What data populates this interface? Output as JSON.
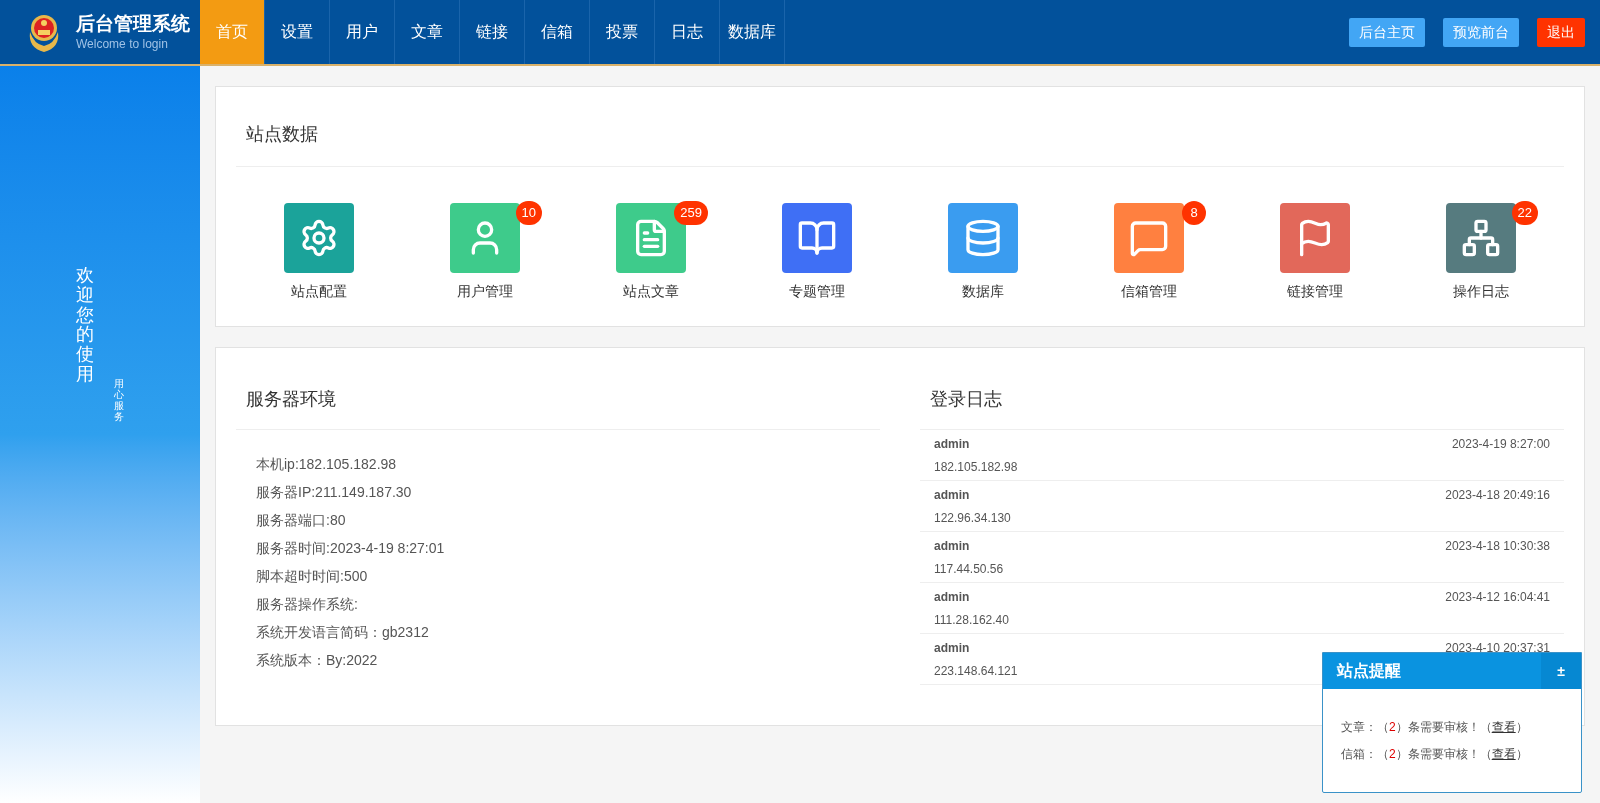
{
  "brand": {
    "title": "后台管理系统",
    "subtitle": "Welcome to login"
  },
  "nav": [
    {
      "label": "首页",
      "selected": true
    },
    {
      "label": "设置",
      "selected": false
    },
    {
      "label": "用户",
      "selected": false
    },
    {
      "label": "文章",
      "selected": false
    },
    {
      "label": "链接",
      "selected": false
    },
    {
      "label": "信箱",
      "selected": false
    },
    {
      "label": "投票",
      "selected": false
    },
    {
      "label": "日志",
      "selected": false
    },
    {
      "label": "数据库",
      "selected": false
    }
  ],
  "header_buttons": [
    {
      "label": "后台主页",
      "kind": "normal"
    },
    {
      "label": "预览前台",
      "kind": "normal"
    },
    {
      "label": "退出",
      "kind": "danger"
    }
  ],
  "sidebar": {
    "welcome": "欢迎您的使用",
    "motto": "用心服务"
  },
  "site_data": {
    "title": "站点数据",
    "items": [
      {
        "label": "站点配置",
        "kind": "config",
        "color": "#1ba39a"
      },
      {
        "label": "用户管理",
        "kind": "user",
        "color": "#3ecb8b",
        "badge": "10"
      },
      {
        "label": "站点文章",
        "kind": "article",
        "color": "#3ecb8b",
        "badge": "259"
      },
      {
        "label": "专题管理",
        "kind": "topic",
        "color": "#3f6ff5"
      },
      {
        "label": "数据库",
        "kind": "database",
        "color": "#3a9cf0"
      },
      {
        "label": "信箱管理",
        "kind": "mail",
        "color": "#ff8040",
        "badge": "8"
      },
      {
        "label": "链接管理",
        "kind": "link",
        "color": "#e2685a"
      },
      {
        "label": "操作日志",
        "kind": "log",
        "color": "#567b7f",
        "badge": "22"
      }
    ]
  },
  "server": {
    "title": "服务器环境",
    "lines": [
      "本机ip:182.105.182.98",
      "服务器IP:211.149.187.30",
      "服务器端口:80",
      "服务器时间:2023-4-19 8:27:01",
      "脚本超时时间:500",
      "服务器操作系统:",
      "系统开发语言简码：gb2312",
      "系统版本：By:2022"
    ]
  },
  "login_log": {
    "title": "登录日志",
    "rows": [
      {
        "user": "admin",
        "time": "2023-4-19 8:27:00",
        "ip": "182.105.182.98"
      },
      {
        "user": "admin",
        "time": "2023-4-18 20:49:16",
        "ip": "122.96.34.130"
      },
      {
        "user": "admin",
        "time": "2023-4-18 10:30:38",
        "ip": "117.44.50.56"
      },
      {
        "user": "admin",
        "time": "2023-4-12 16:04:41",
        "ip": "111.28.162.40"
      },
      {
        "user": "admin",
        "time": "2023-4-10 20:37:31",
        "ip": "223.148.64.121"
      }
    ]
  },
  "reminder": {
    "title": "站点提醒",
    "toggle": "±",
    "lines": [
      {
        "label": "文章：",
        "open": "（",
        "count": "2",
        "middle": "）条需要审核！（",
        "link": "查看",
        "close": "）"
      },
      {
        "label": "信箱：",
        "open": "（",
        "count": "2",
        "middle": "）条需要审核！（",
        "link": "查看",
        "close": "）"
      }
    ]
  }
}
